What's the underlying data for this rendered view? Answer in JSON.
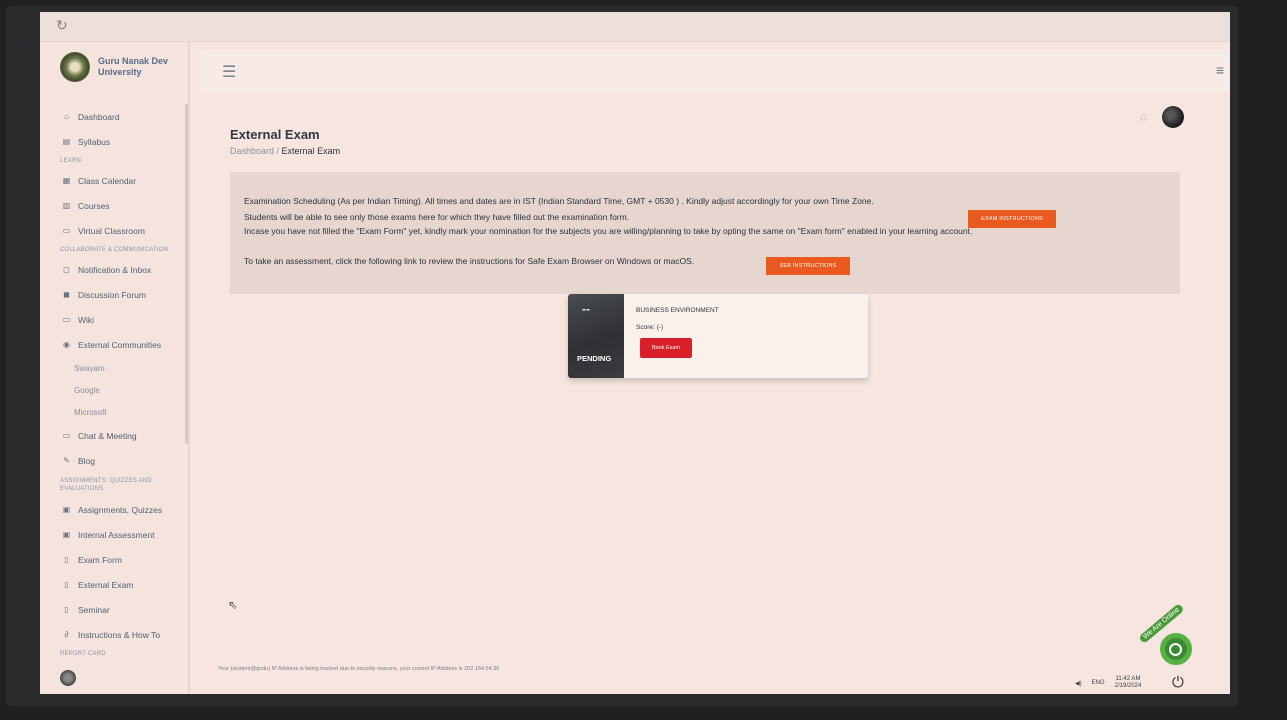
{
  "brand": {
    "name": "Guru Nanak Dev University"
  },
  "sidebar": {
    "items": [
      {
        "type": "item",
        "icon": "home-icon",
        "glyph": "⌂",
        "label": "Dashboard"
      },
      {
        "type": "item",
        "icon": "syllabus-icon",
        "glyph": "▤",
        "label": "Syllabus"
      },
      {
        "type": "section",
        "label": "LEARN"
      },
      {
        "type": "item",
        "icon": "calendar-icon",
        "glyph": "▦",
        "label": "Class Calendar"
      },
      {
        "type": "item",
        "icon": "courses-icon",
        "glyph": "▥",
        "label": "Courses"
      },
      {
        "type": "item",
        "icon": "monitor-icon",
        "glyph": "▭",
        "label": "Virtual Classroom"
      },
      {
        "type": "section",
        "label": "COLLABORATE & COMMUNICATION"
      },
      {
        "type": "item",
        "icon": "bell-icon",
        "glyph": "◻",
        "label": "Notification & Inbox"
      },
      {
        "type": "item",
        "icon": "forum-icon",
        "glyph": "◼",
        "label": "Discussion Forum"
      },
      {
        "type": "item",
        "icon": "wiki-icon",
        "glyph": "▭",
        "label": "Wiki"
      },
      {
        "type": "item",
        "icon": "globe-icon",
        "glyph": "◉",
        "label": "External Communities"
      },
      {
        "type": "sub",
        "label": "Swayam"
      },
      {
        "type": "sub",
        "label": "Google"
      },
      {
        "type": "sub",
        "label": "Microsoft"
      },
      {
        "type": "item",
        "icon": "chat-icon",
        "glyph": "▭",
        "label": "Chat & Meeting"
      },
      {
        "type": "item",
        "icon": "blog-icon",
        "glyph": "✎",
        "label": "Blog"
      },
      {
        "type": "section2",
        "label": "ASSIGNMENTS, QUIZZES AND EVALUATIONS"
      },
      {
        "type": "item",
        "icon": "assignment-icon",
        "glyph": "▣",
        "label": "Assignments, Quizzes"
      },
      {
        "type": "item",
        "icon": "assessment-icon",
        "glyph": "▣",
        "label": "Internal Assessment"
      },
      {
        "type": "item",
        "icon": "document-icon",
        "glyph": "▯",
        "label": "Exam Form"
      },
      {
        "type": "item",
        "icon": "document-icon",
        "glyph": "▯",
        "label": "External Exam"
      },
      {
        "type": "item",
        "icon": "document-icon",
        "glyph": "▯",
        "label": "Seminar"
      },
      {
        "type": "item",
        "icon": "link-icon",
        "glyph": "∂",
        "label": "Instructions & How To"
      },
      {
        "type": "section",
        "label": "REPORT CARD"
      }
    ]
  },
  "page": {
    "title": "External Exam",
    "breadcrumb_root": "Dashboard",
    "breadcrumb_sep": " / ",
    "breadcrumb_current": "External Exam"
  },
  "info": {
    "line1": "Examination Scheduling (As per Indian Timing). All times and dates are in IST (Indian Standard Time, GMT + 0530 ) . Kindly adjust accordingly for your own Time Zone.",
    "exam_instructions_btn": "EXAM INSTRUCTIONS",
    "line2": "Students will be able to see only those exams here for which they have filled out the examination form.",
    "line3": "Incase you have not filled the \"Exam Form\" yet, kindly mark your nomination for the subjects you are willing/planning to take by opting the same on \"Exam form\" enabled in your learning account.",
    "line4": "To take an assessment, click the following link to review the instructions for Safe Exam Browser on Windows or macOS.",
    "seb_instructions_btn": "SEB INSTRUCTIONS"
  },
  "exam_card": {
    "thumb_text": "--",
    "status": "PENDING",
    "name": "BUSINESS ENVIRONMENT",
    "score": "Score: (-)",
    "book_btn": "Book Exam"
  },
  "footer": {
    "note": "Your (student@gndu) IP Address is being tracked due to security reasons, your current IP Address is 202.164.54.36"
  },
  "widget": {
    "label": "We Are Online"
  },
  "tray": {
    "lang": "ENG",
    "time": "11:42 AM",
    "date": "2/19/2024"
  },
  "colors": {
    "accent_orange": "#e85a1f",
    "book_red": "#d8202a",
    "widget_green": "#3c8b32"
  }
}
